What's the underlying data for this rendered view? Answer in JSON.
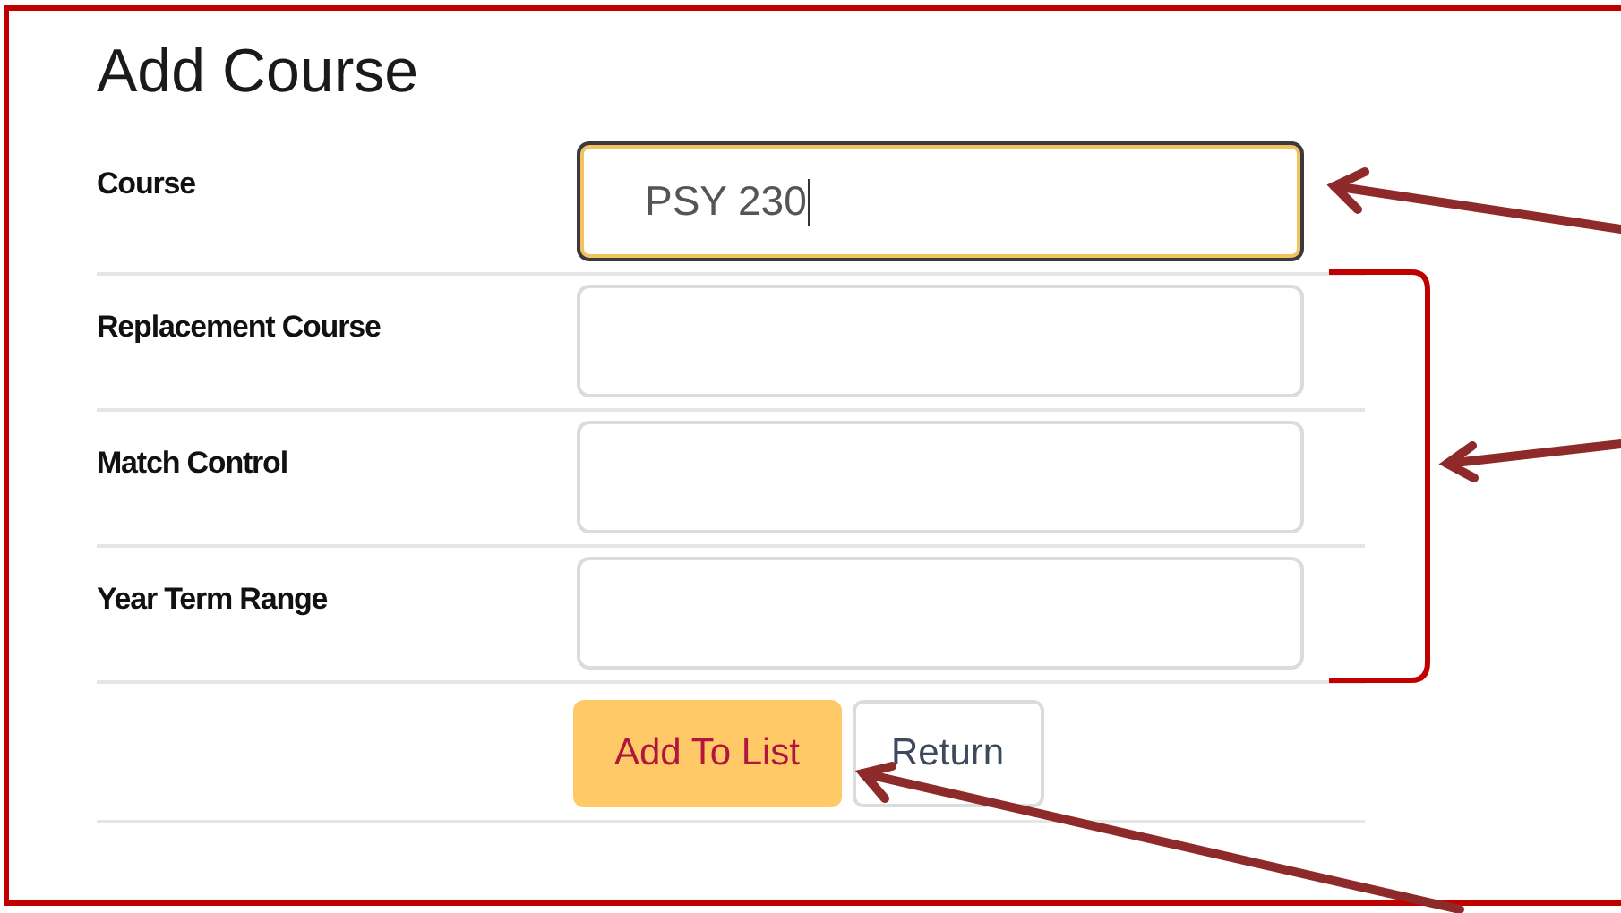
{
  "title": "Add Course",
  "fields": [
    {
      "label": "Course",
      "value": "PSY 230",
      "focused": true
    },
    {
      "label": "Replacement Course",
      "focused": false
    },
    {
      "label": "Match Control",
      "focused": false
    },
    {
      "label": "Year Term Range",
      "focused": false
    }
  ],
  "buttons": [
    {
      "label": "Add To List",
      "kind": "primary"
    },
    {
      "label": "Return",
      "kind": "secondary"
    }
  ]
}
